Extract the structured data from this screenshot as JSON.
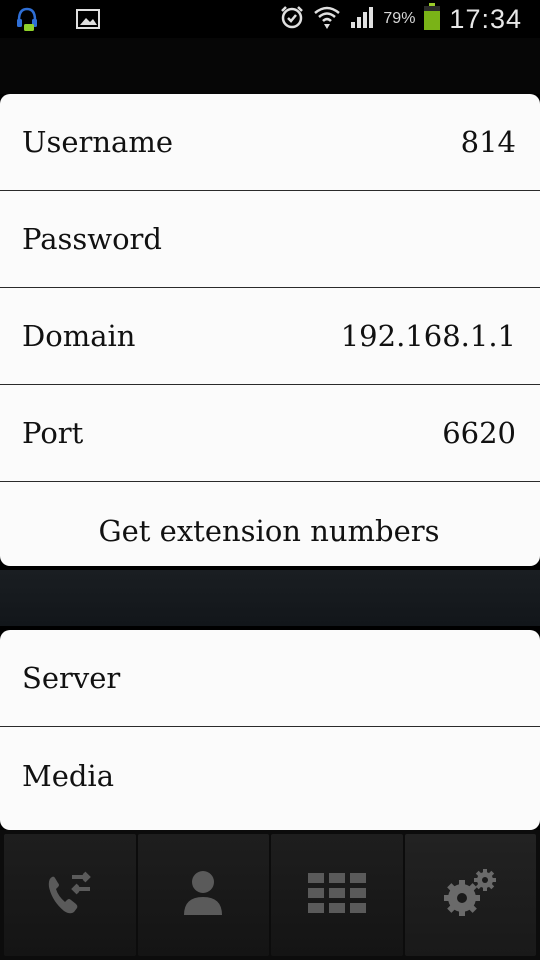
{
  "status_bar": {
    "battery_percent": "79%",
    "time": "17:34"
  },
  "account": {
    "rows": [
      {
        "label": "Username",
        "value": "814"
      },
      {
        "label": "Password",
        "value": ""
      },
      {
        "label": "Domain",
        "value": "192.168.1.1"
      },
      {
        "label": "Port",
        "value": "6620"
      }
    ],
    "get_extensions_label": "Get extension numbers"
  },
  "settings": {
    "rows": [
      {
        "label": "Server"
      },
      {
        "label": "Media"
      }
    ]
  },
  "bottom_nav": {
    "items": [
      {
        "icon": "call-transfer-icon",
        "active": false
      },
      {
        "icon": "contact-icon",
        "active": false
      },
      {
        "icon": "dialpad-icon",
        "active": false
      },
      {
        "icon": "settings-gears-icon",
        "active": true
      }
    ]
  },
  "colors": {
    "background": "#000000",
    "card": "#fbfbfb",
    "divider": "#2a2a2a",
    "icon_gray": "#5a5a5a",
    "battery_green": "#7ab317"
  }
}
